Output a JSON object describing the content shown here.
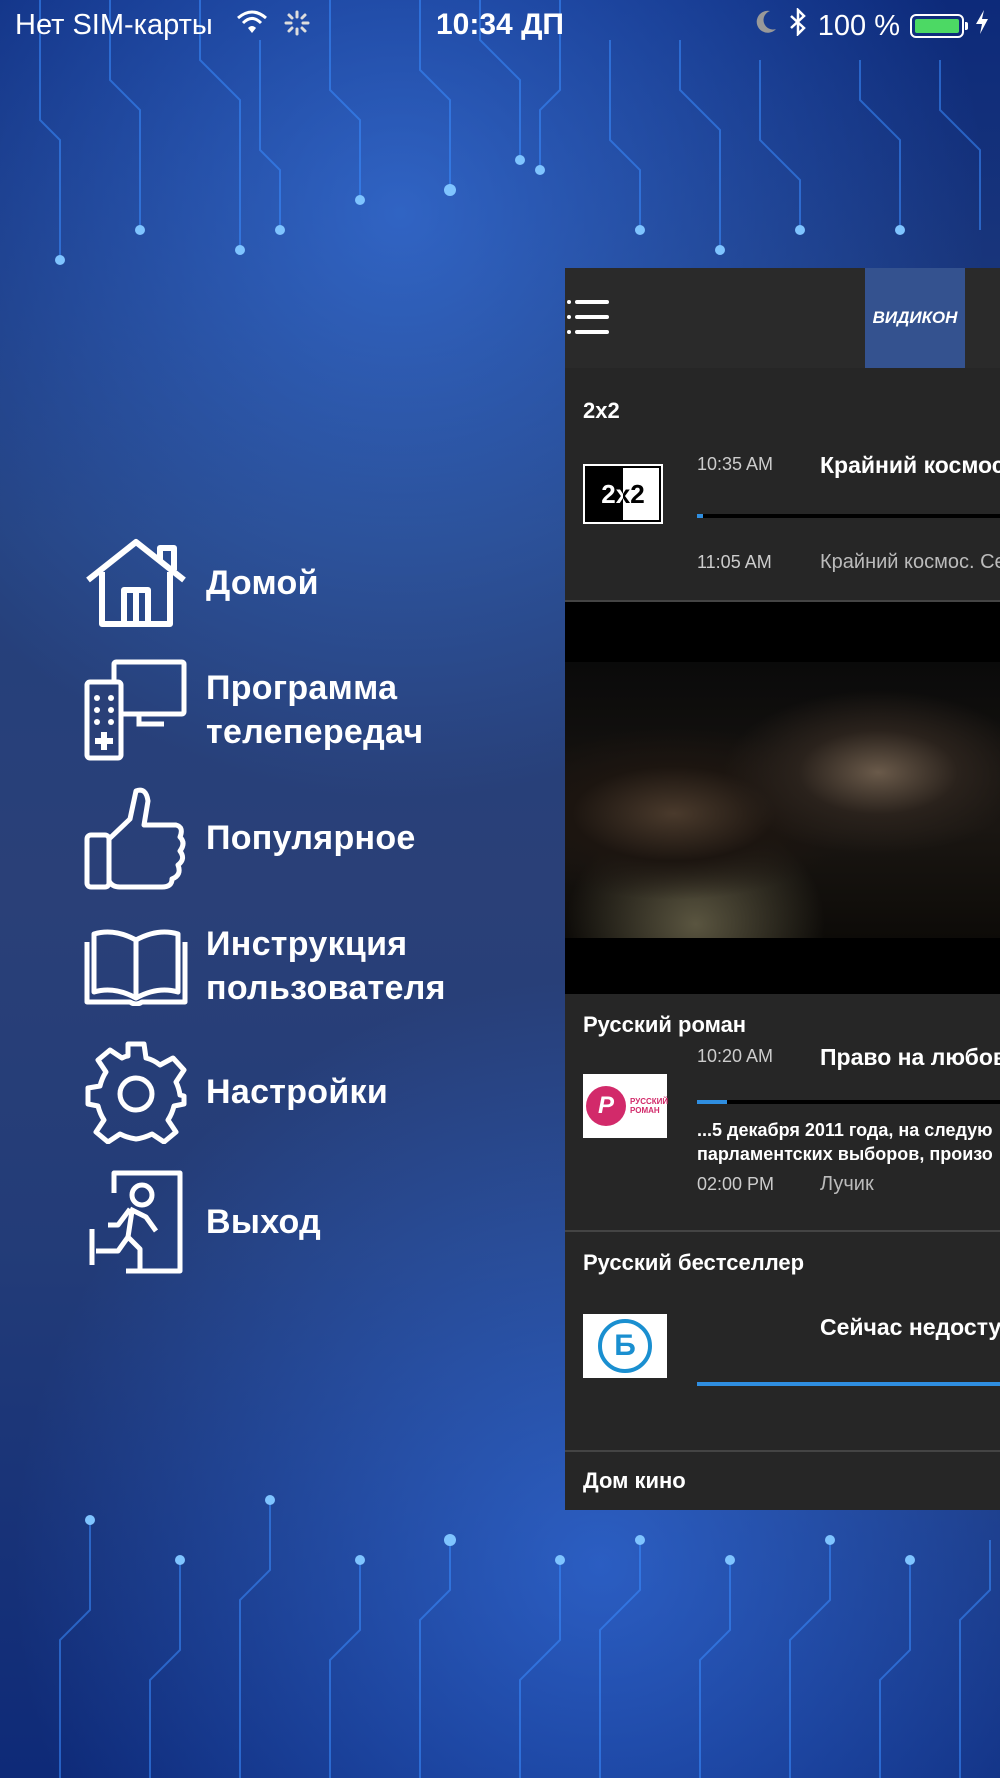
{
  "status_bar": {
    "carrier": "Нет SIM-карты",
    "time": "10:34 ДП",
    "battery": "100 %",
    "battery_level": 1.0,
    "battery_color": "#4cd964"
  },
  "menu": {
    "items": [
      {
        "label": "Домой",
        "icon": "home-icon"
      },
      {
        "label": "Программа телепередач",
        "line1": "Программа",
        "line2": "телепередач",
        "icon": "tv-remote-icon"
      },
      {
        "label": "Популярное",
        "icon": "thumbs-up-icon"
      },
      {
        "label": "Инструкция пользователя",
        "line1": "Инструкция",
        "line2": "пользователя",
        "icon": "book-icon"
      },
      {
        "label": "Настройки",
        "icon": "gear-icon"
      },
      {
        "label": "Выход",
        "icon": "exit-icon"
      }
    ]
  },
  "header": {
    "logo_text": "ВИДИКОН",
    "logo_color": "#34528f"
  },
  "channels": [
    {
      "name": "2x2",
      "logo_text": "2x2",
      "time": "10:35 AM",
      "show": "Крайний космос",
      "progress": 0.02,
      "next_time": "11:05 AM",
      "next_show": "Крайний космос. Се"
    },
    {
      "name": "Русский роман",
      "logo_text": "РУССКИЙ РОМАН",
      "time": "10:20 AM",
      "show": "Право на любовь",
      "progress": 0.1,
      "desc_line1": "...5 декабря 2011 года, на следую",
      "desc_line2": "парламентских выборов, произо",
      "next_time": "02:00 PM",
      "next_show": "Лучик"
    },
    {
      "name": "Русский бестселлер",
      "logo_text": "Б",
      "show": "Сейчас недоступ",
      "progress": 1.0
    },
    {
      "name": "Дом кино"
    }
  ],
  "accent_color": "#2f8ee0"
}
